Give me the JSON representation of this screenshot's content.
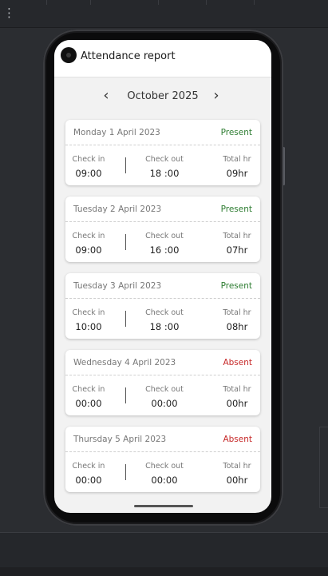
{
  "app": {
    "title": "Attendance report"
  },
  "month_nav": {
    "prev_icon": "‹",
    "next_icon": "›",
    "label": "October 2025"
  },
  "column_labels": {
    "check_in": "Check in",
    "check_out": "Check out",
    "total": "Total hr"
  },
  "records": [
    {
      "date": "Monday 1 April 2023",
      "status": "Present",
      "check_in": "09:00",
      "check_out": "18 :00",
      "total": "09hr"
    },
    {
      "date": "Tuesday 2 April 2023",
      "status": "Present",
      "check_in": "09:00",
      "check_out": "16 :00",
      "total": "07hr"
    },
    {
      "date": "Tuesday  3 April 2023",
      "status": "Present",
      "check_in": "10:00",
      "check_out": "18 :00",
      "total": "08hr"
    },
    {
      "date": "Wednesday 4 April 2023",
      "status": "Absent",
      "check_in": "00:00",
      "check_out": "00:00",
      "total": "00hr"
    },
    {
      "date": "Thursday 5 April 2023",
      "status": "Absent",
      "check_in": "00:00",
      "check_out": "00:00",
      "total": "00hr"
    }
  ],
  "colors": {
    "present": "#2e7d32",
    "absent": "#c62828"
  }
}
